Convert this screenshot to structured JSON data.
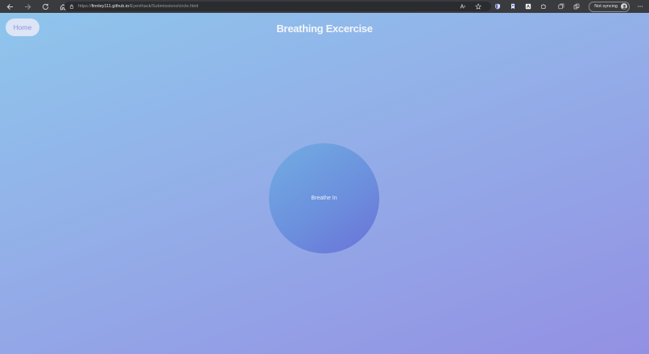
{
  "browser": {
    "url_scheme": "https://",
    "url_host": "finnley111.github.io",
    "url_path": "/Eyenthack/Submissions/circle.html",
    "sync_label": "Not syncing"
  },
  "header": {
    "home_label": "Home",
    "title": "Breathing Excercise"
  },
  "exercise": {
    "instruction": "Breathe In"
  },
  "colors": {
    "background_start": "#8ec5ec",
    "background_end": "#9390e3",
    "circle_start": "#72ade2",
    "circle_end": "#6a72d8"
  }
}
